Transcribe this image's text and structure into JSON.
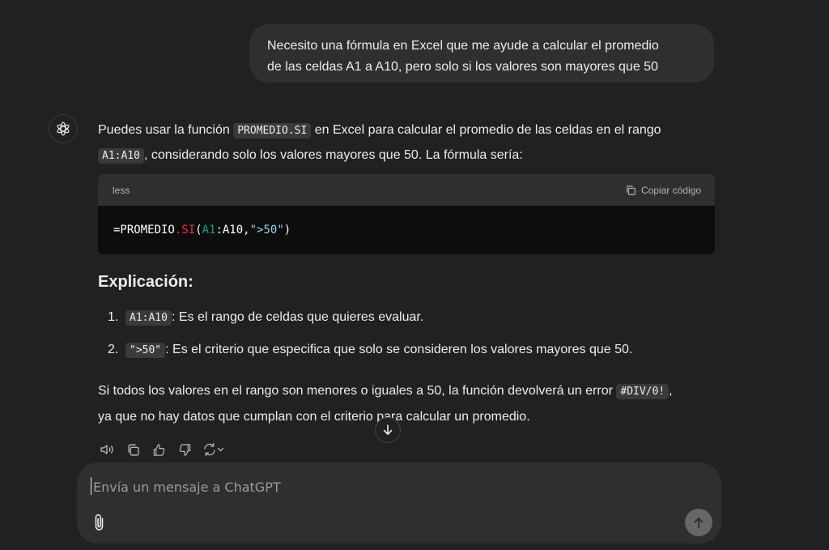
{
  "user_message": {
    "line1": "Necesito una fórmula en Excel que me ayude a calcular el promedio",
    "line2": "de las celdas A1 a A10, pero solo si los valores son mayores que 50"
  },
  "assistant": {
    "avatar_icon": "openai-logo-icon",
    "intro_part1": "Puedes usar la función ",
    "intro_code1": "PROMEDIO.SI",
    "intro_part2": " en Excel para calcular el promedio de las celdas en el rango",
    "intro_code2": "A1:A10",
    "intro_part3": ", considerando solo los valores mayores que 50. La fórmula sería:",
    "code_block": {
      "language": "less",
      "copy_label": "Copiar código",
      "tokens": {
        "t1": "=PROMEDIO",
        "t2": ".SI",
        "t3": "(",
        "t4": "A1",
        "t5": ":A10, ",
        "t6": "\">50\"",
        "t7": ")"
      }
    },
    "heading": "Explicación:",
    "list": [
      {
        "num": "1.",
        "code": "A1:A10",
        "text": ": Es el rango de celdas que quieres evaluar."
      },
      {
        "num": "2.",
        "code": "\">50\"",
        "text": ": Es el criterio que especifica que solo se consideren los valores mayores que 50."
      }
    ],
    "closing_part1": "Si todos los valores en el rango son menores o iguales a 50, la función devolverá un error ",
    "closing_code": "#DIV/0!",
    "closing_part2": ",",
    "closing_line2": "ya que no hay datos que cumplan con el criterio para calcular un promedio."
  },
  "actions": [
    "speaker-icon",
    "copy-icon",
    "thumbs-up-icon",
    "thumbs-down-icon",
    "regenerate-icon"
  ],
  "composer": {
    "placeholder": "Envía un mensaje a ChatGPT"
  },
  "colors": {
    "background": "#212121",
    "surface": "#2f2f2f",
    "code_bg": "#0d0d0d",
    "token_red": "#f22c3d",
    "token_green": "#00a67d",
    "token_string": "#9ad3f3"
  }
}
